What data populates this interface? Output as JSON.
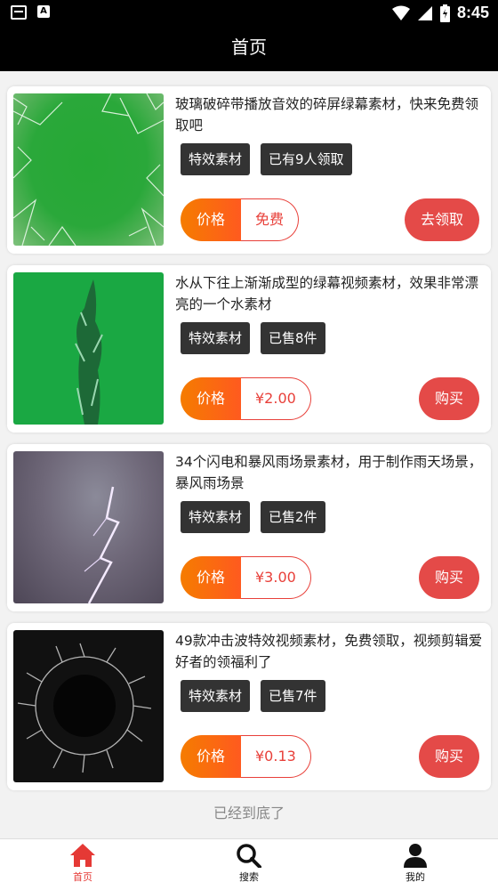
{
  "statusbar": {
    "time": "8:45"
  },
  "header": {
    "title": "首页"
  },
  "common": {
    "tag_effect": "特效素材",
    "price_label": "价格"
  },
  "items": [
    {
      "desc": "玻璃破碎带播放音效的碎屏绿幕素材，快来免费领取吧",
      "count": "已有9人领取",
      "price": "免费",
      "action": "去领取"
    },
    {
      "desc": "水从下往上渐渐成型的绿幕视频素材，效果非常漂亮的一个水素材",
      "count": "已售8件",
      "price": "¥2.00",
      "action": "购买"
    },
    {
      "desc": "34个闪电和暴风雨场景素材，用于制作雨天场景，暴风雨场景",
      "count": "已售2件",
      "price": "¥3.00",
      "action": "购买"
    },
    {
      "desc": "49款冲击波特效视频素材，免费领取，视频剪辑爱好者的领福利了",
      "count": "已售7件",
      "price": "¥0.13",
      "action": "购买"
    }
  ],
  "list_end": "已经到底了",
  "tabs": [
    {
      "label": "首页",
      "icon": "home-icon",
      "active": true
    },
    {
      "label": "搜索",
      "icon": "search-icon"
    },
    {
      "label": "我的",
      "icon": "user-icon"
    }
  ]
}
